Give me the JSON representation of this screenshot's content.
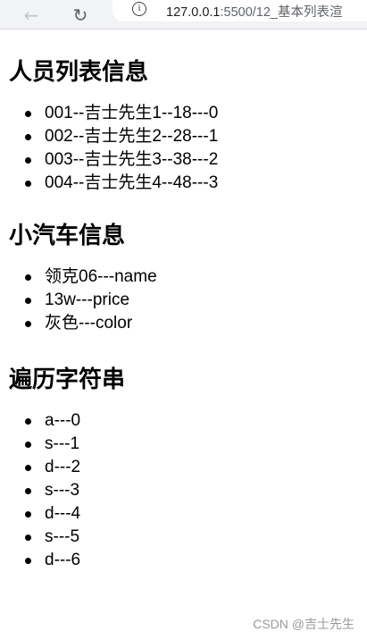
{
  "browser": {
    "back_icon": "←",
    "reload_icon": "↻",
    "info_icon": "i",
    "url_host": "127.0.0.1",
    "url_rest": ":5500/12_基本列表渲"
  },
  "sections": {
    "person": {
      "title": "人员列表信息",
      "items": [
        "001--吉士先生1--18---0",
        "002--吉士先生2--28---1",
        "003--吉士先生3--38---2",
        "004--吉士先生4--48---3"
      ]
    },
    "car": {
      "title": "小汽车信息",
      "items": [
        "领克06---name",
        "13w---price",
        "灰色---color"
      ]
    },
    "string": {
      "title": "遍历字符串",
      "items": [
        "a---0",
        "s---1",
        "d---2",
        "s---3",
        "d---4",
        "s---5",
        "d---6"
      ]
    }
  },
  "watermark": "CSDN @吉士先生"
}
